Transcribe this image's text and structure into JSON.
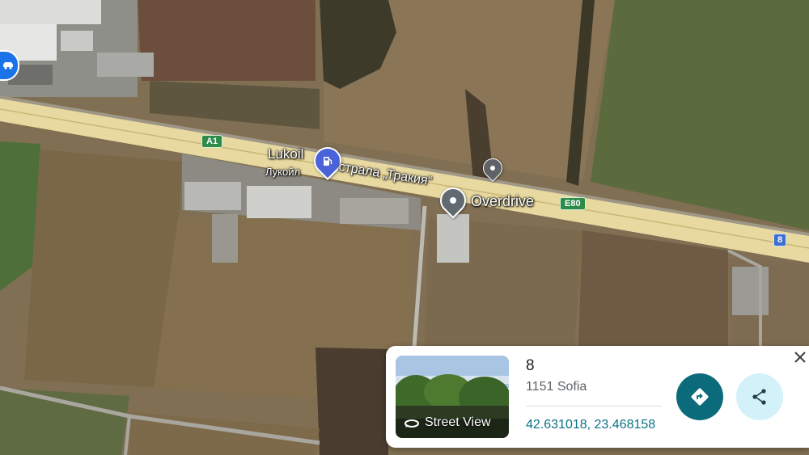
{
  "map": {
    "labels": {
      "lukoil_latin": "Lukoil",
      "lukoil_cyrillic": "Лукойл",
      "highway_name": "страла „Тракия“",
      "overdrive": "Overdrive"
    },
    "road_shields": {
      "a1": "A1",
      "e80": "E80",
      "route_8": "8"
    },
    "icons": {
      "fuel_pin": "fuel-pump-icon",
      "small_pin": "location-pin-icon",
      "dropped_pin": "dropped-pin-icon",
      "left_control": "location-icon"
    }
  },
  "place_card": {
    "street_view_label": "Street View",
    "title": "8",
    "address": "1151 Sofia",
    "coordinates": "42.631018, 23.468158",
    "buttons": {
      "directions_icon": "directions-icon",
      "share_icon": "share-icon",
      "close_icon": "close-icon"
    },
    "colors": {
      "directions_button": "#0b6b7a",
      "share_button": "#d3f1f8",
      "coordinates_text": "#0b7285"
    }
  }
}
